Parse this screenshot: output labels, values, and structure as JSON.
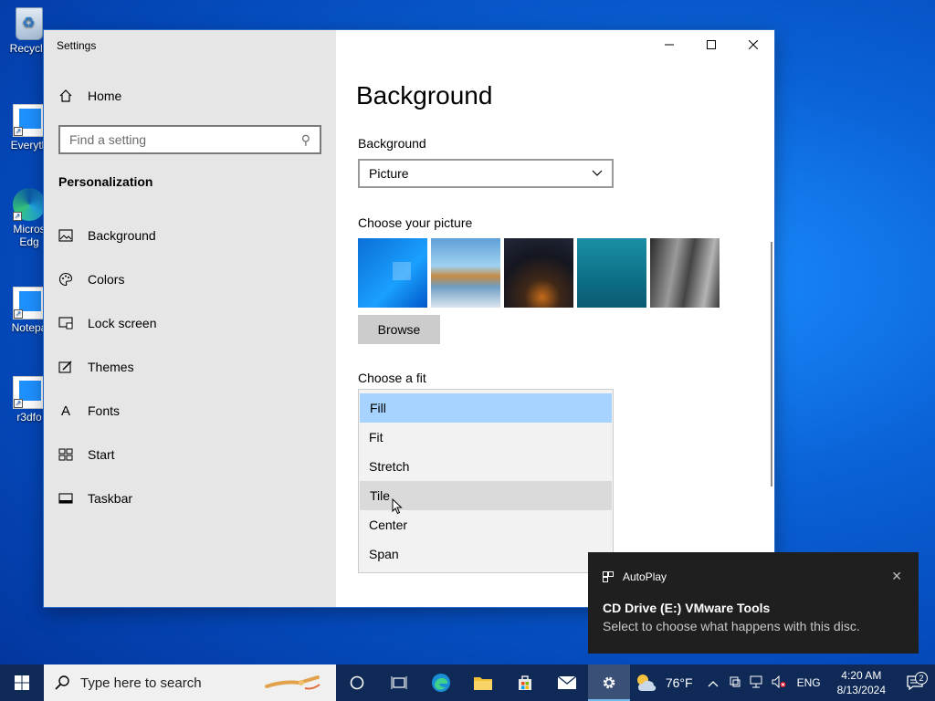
{
  "desktop": {
    "icons": [
      {
        "label": "Recycle"
      },
      {
        "label": "Everyth"
      },
      {
        "label": "Micros Edg"
      },
      {
        "label": "Notepa"
      },
      {
        "label": "r3dfo"
      }
    ]
  },
  "window": {
    "title": "Settings",
    "controls": {
      "minimize": "—",
      "maximize": "☐",
      "close": "✕"
    }
  },
  "sidebar": {
    "home_label": "Home",
    "search_placeholder": "Find a setting",
    "section_title": "Personalization",
    "items": [
      {
        "label": "Background",
        "icon": "picture-icon"
      },
      {
        "label": "Colors",
        "icon": "palette-icon"
      },
      {
        "label": "Lock screen",
        "icon": "lock-screen-icon"
      },
      {
        "label": "Themes",
        "icon": "themes-icon"
      },
      {
        "label": "Fonts",
        "icon": "fonts-icon"
      },
      {
        "label": "Start",
        "icon": "start-icon"
      },
      {
        "label": "Taskbar",
        "icon": "taskbar-icon"
      }
    ]
  },
  "content": {
    "page_title": "Background",
    "background_label": "Background",
    "background_value": "Picture",
    "choose_picture_label": "Choose your picture",
    "browse_label": "Browse",
    "fit_label": "Choose a fit",
    "fit_options": [
      "Fill",
      "Fit",
      "Stretch",
      "Tile",
      "Center",
      "Span"
    ],
    "fit_selected": "Fill",
    "fit_hovered": "Tile"
  },
  "toast": {
    "app_name": "AutoPlay",
    "heading": "CD Drive (E:) VMware Tools",
    "body": "Select to choose what happens with this disc.",
    "close": "✕"
  },
  "taskbar": {
    "search_placeholder": "Type here to search",
    "weather": "76°F",
    "language": "ENG",
    "time": "4:20 AM",
    "date": "8/13/2024",
    "notification_count": "2",
    "colors": {
      "bg": "#0f2a56",
      "accent": "#76b9ed"
    }
  }
}
